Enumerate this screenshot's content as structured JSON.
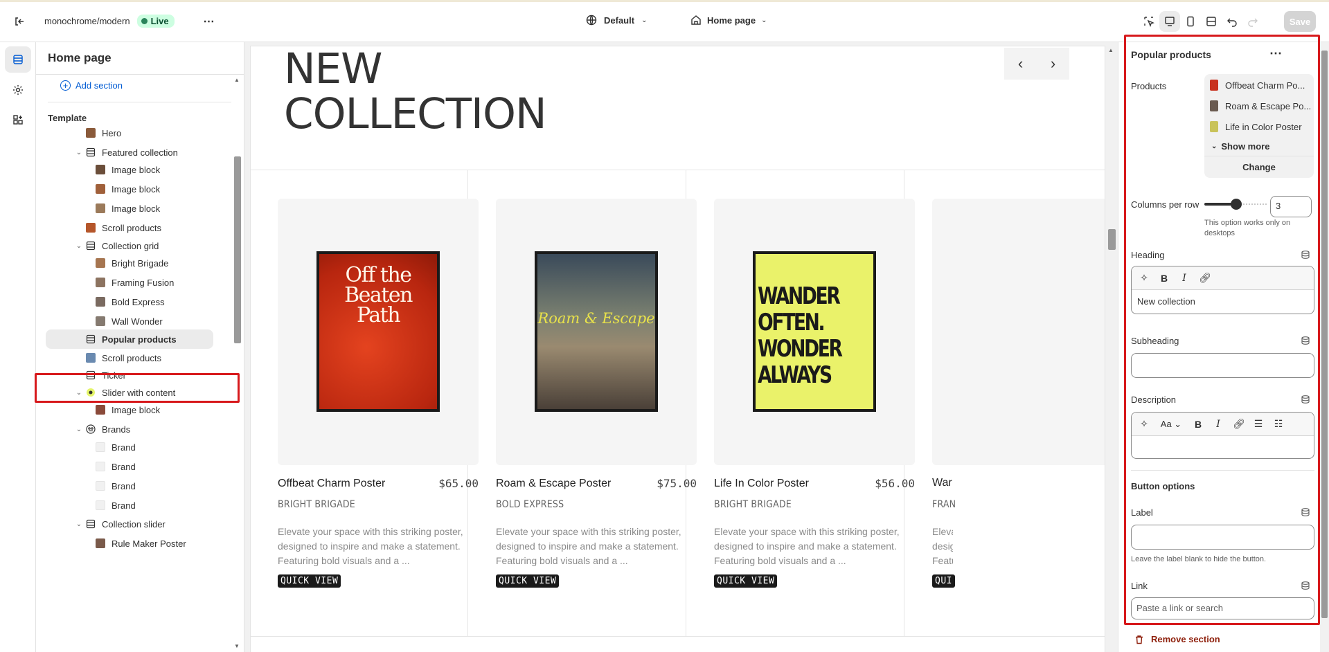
{
  "topbar": {
    "store_name": "monochrome/modern",
    "live_badge": "Live",
    "theme_selector": "Default",
    "page_selector": "Home page",
    "save_label": "Save"
  },
  "sidebar": {
    "title": "Home page",
    "add_section": "Add section",
    "template_label": "Template",
    "items": [
      {
        "label": "Hero",
        "level": 0,
        "expanded": null,
        "icon": "image-thumb",
        "color": "#8a5a3a"
      },
      {
        "label": "Featured collection",
        "level": 0,
        "expanded": true,
        "icon": "section-icon"
      },
      {
        "label": "Image block",
        "level": 1,
        "icon": "image-thumb",
        "color": "#6b4e3a"
      },
      {
        "label": "Image block",
        "level": 1,
        "icon": "image-thumb",
        "color": "#a0603a"
      },
      {
        "label": "Image block",
        "level": 1,
        "icon": "image-thumb",
        "color": "#9b7a5a"
      },
      {
        "label": "Scroll products",
        "level": 0,
        "expanded": null,
        "icon": "image-thumb",
        "color": "#b5562a"
      },
      {
        "label": "Collection grid",
        "level": 0,
        "expanded": true,
        "icon": "section-icon"
      },
      {
        "label": "Bright Brigade",
        "level": 1,
        "icon": "image-thumb",
        "color": "#a67550"
      },
      {
        "label": "Framing Fusion",
        "level": 1,
        "icon": "image-thumb",
        "color": "#8c7360"
      },
      {
        "label": "Bold Express",
        "level": 1,
        "icon": "image-thumb",
        "color": "#7a6a60"
      },
      {
        "label": "Wall Wonder",
        "level": 1,
        "icon": "image-thumb",
        "color": "#857a70"
      },
      {
        "label": "Popular products",
        "level": 0,
        "expanded": null,
        "icon": "section-icon",
        "selected": true
      },
      {
        "label": "Scroll products",
        "level": 0,
        "expanded": null,
        "icon": "image-thumb",
        "color": "#6a8ab0"
      },
      {
        "label": "Ticker",
        "level": 0,
        "expanded": null,
        "icon": "section-icon"
      },
      {
        "label": "Slider with content",
        "level": 0,
        "expanded": true,
        "icon": "slider-icon"
      },
      {
        "label": "Image block",
        "level": 1,
        "icon": "image-thumb",
        "color": "#8a4a3a"
      },
      {
        "label": "Brands",
        "level": 0,
        "expanded": true,
        "icon": "brands-icon"
      },
      {
        "label": "Brand",
        "level": 1,
        "icon": "brand-thumb"
      },
      {
        "label": "Brand",
        "level": 1,
        "icon": "brand-thumb"
      },
      {
        "label": "Brand",
        "level": 1,
        "icon": "brand-thumb"
      },
      {
        "label": "Brand",
        "level": 1,
        "icon": "brand-thumb"
      },
      {
        "label": "Collection slider",
        "level": 0,
        "expanded": true,
        "icon": "section-icon"
      },
      {
        "label": "Rule Maker Poster",
        "level": 1,
        "icon": "image-thumb",
        "color": "#7a5a4a"
      }
    ]
  },
  "preview": {
    "heading": "New collection",
    "products": [
      {
        "title": "Offbeat Charm Poster",
        "price": "$65.00",
        "vendor": "BRIGHT BRIGADE",
        "description": "Elevate your space with this striking poster, designed to inspire and make a statement. Featuring bold visuals and a ...",
        "quick_view": "QUICK VIEW",
        "poster_text": "Off the Beaten Path"
      },
      {
        "title": "Roam & Escape Poster",
        "price": "$75.00",
        "vendor": "BOLD EXPRESS",
        "description": "Elevate your space with this striking poster, designed to inspire and make a statement. Featuring bold visuals and a ...",
        "quick_view": "QUICK VIEW",
        "poster_text": "Roam & Escape"
      },
      {
        "title": "Life In Color Poster",
        "price": "$56.00",
        "vendor": "BRIGHT BRIGADE",
        "description": "Elevate your space with this striking poster, designed to inspire and make a statement. Featuring bold visuals and a ...",
        "quick_view": "QUICK VIEW",
        "poster_text": "WANDER OFTEN. WONDER ALWAYS"
      },
      {
        "title": "War",
        "vendor": "FRAN",
        "description": "Eleva desig Featu",
        "quick_view": "QUI"
      }
    ]
  },
  "panel": {
    "title": "Popular products",
    "products_label": "Products",
    "products": [
      {
        "name": "Offbeat Charm Po...",
        "color": "#c8321e"
      },
      {
        "name": "Roam & Escape Po...",
        "color": "#6a5a50"
      },
      {
        "name": "Life in Color Poster",
        "color": "#c9c35a"
      }
    ],
    "show_more": "Show more",
    "change": "Change",
    "columns_label": "Columns per row",
    "columns_value": "3",
    "columns_help": "This option works only on desktops",
    "heading_label": "Heading",
    "heading_value": "New collection",
    "subheading_label": "Subheading",
    "description_label": "Description",
    "button_options": "Button options",
    "label_label": "Label",
    "label_help": "Leave the label blank to hide the button.",
    "link_label": "Link",
    "link_placeholder": "Paste a link or search",
    "remove_section": "Remove section"
  }
}
